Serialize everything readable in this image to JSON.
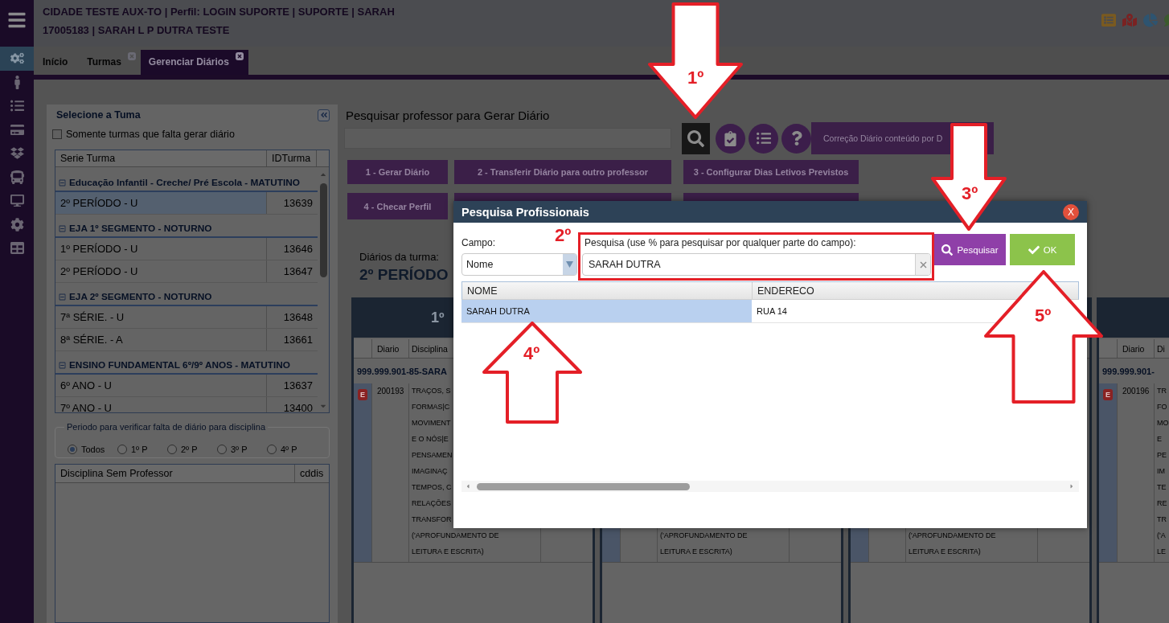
{
  "sidebar": {
    "items": [
      {
        "selected": true
      },
      {
        "selected": false
      },
      {
        "selected": false
      },
      {
        "selected": false
      },
      {
        "selected": false
      },
      {
        "selected": false
      },
      {
        "selected": false
      },
      {
        "selected": false
      },
      {
        "selected": false
      }
    ]
  },
  "header": {
    "lines": [
      "CIDADE TESTE AUX-TO | Perfil: LOGIN SUPORTE | SUPORTE | SARAH",
      "17005183 | SARAH L P DUTRA TESTE"
    ]
  },
  "tabs": [
    {
      "label": "Início",
      "selected": false,
      "closable": false
    },
    {
      "label": "Turmas",
      "selected": false,
      "closable": true
    },
    {
      "label": "Gerenciar Diários",
      "selected": true,
      "closable": true
    }
  ],
  "class_panel": {
    "title": "Selecione a Tuma",
    "filter": {
      "label": "Somente turmas que falta gerar diário",
      "checked": false
    },
    "grid": {
      "columns": [
        "Serie Turma",
        "IDTurma"
      ],
      "groups": [
        {
          "title": "Educação Infantil - Creche/ Pré Escola - MATUTINO",
          "expanded": true,
          "rows": [
            {
              "serie": "2º PERÍODO - U",
              "id": "13639",
              "selected": true
            }
          ]
        },
        {
          "title": "EJA 1º SEGMENTO - NOTURNO",
          "expanded": true,
          "rows": [
            {
              "serie": "1º PERÍODO - U",
              "id": "13646",
              "selected": false
            },
            {
              "serie": "2º PERÍODO - U",
              "id": "13647",
              "selected": false
            }
          ]
        },
        {
          "title": "EJA 2º SEGMENTO - NOTURNO",
          "expanded": true,
          "rows": [
            {
              "serie": "7ª SÉRIE. - U",
              "id": "13648",
              "selected": false
            },
            {
              "serie": "8ª SÉRIE. - A",
              "id": "13661",
              "selected": false
            }
          ]
        },
        {
          "title": "ENSINO FUNDAMENTAL 6º/9º ANOS - MATUTINO",
          "expanded": true,
          "rows": [
            {
              "serie": "6º ANO - U",
              "id": "13637",
              "selected": false
            },
            {
              "serie": "7º ANO - U",
              "id": "13400",
              "selected": false
            }
          ]
        }
      ]
    },
    "period": {
      "legend": "Periodo para verificar falta de diário para disciplina",
      "options": [
        {
          "label": "Todos",
          "selected": true
        },
        {
          "label": "1º P",
          "selected": false
        },
        {
          "label": "2º P",
          "selected": false
        },
        {
          "label": "3º P",
          "selected": false
        },
        {
          "label": "4º P",
          "selected": false
        }
      ]
    },
    "subject_grid": {
      "columns": [
        "Disciplina Sem Professor",
        "cddis"
      ]
    }
  },
  "teacher_search": {
    "title": "Pesquisar professor para Gerar Diário",
    "correction_button": "Correção Diário conteúdo por D",
    "actions": [
      [
        {
          "label": "1 - Gerar Diário"
        },
        {
          "label": "2 - Transferir Diário para outro professor"
        },
        {
          "label": "3 - Configurar Dias Letivos Previstos"
        }
      ],
      [
        {
          "label": "4 - Checar Perfil"
        }
      ]
    ]
  },
  "diaries": {
    "label": "Diários da turma:",
    "class_name": "2º PERÍODO",
    "cards": [
      {
        "title": "1º",
        "columns": [
          "Diario",
          "Disciplina"
        ],
        "teacher": "999.999.901-85-SARA",
        "rows": [
          {
            "badge": "E",
            "diario": "200193",
            "disciplina": [
              "TRAÇOS, S",
              "FORMAS|C",
              "MOVIMENT",
              "E O NÓS|E",
              "PENSAMEN",
              "IMAGINAÇ",
              "TEMPOS, C",
              "RELAÇÕES",
              "TRANSFOR",
              "('APROFUNDAMENTO DE",
              "LEITURA E ESCRITA)"
            ]
          }
        ]
      },
      {
        "rows": [
          {
            "disciplina": [
              "('APROFUNDAMENTO DE",
              "LEITURA E ESCRITA)"
            ]
          }
        ]
      },
      {
        "rows": [
          {
            "disciplina": [
              "('APROFUNDAMENTO DE",
              "LEITURA E ESCRITA)"
            ]
          }
        ]
      },
      {
        "columns": [
          "Diario",
          "Di"
        ],
        "teacher": "999.999.901-",
        "rows": [
          {
            "badge": "E",
            "diario": "200196",
            "disciplina": [
              "TR",
              "FO",
              "MO",
              "E",
              "PE",
              "IM",
              "TE",
              "RE",
              "TR",
              "('A",
              "LE"
            ]
          }
        ]
      }
    ]
  },
  "search_dialog": {
    "title": "Pesquisa Profissionais",
    "close_label": "X",
    "field_label": "Campo:",
    "field_value": "Nome",
    "query_label": "Pesquisa (use % para pesquisar por qualquer parte do campo):",
    "query_value": "SARAH DUTRA",
    "search_button": "Pesquisar",
    "ok_button": "OK",
    "results": {
      "columns": [
        "NOME",
        "ENDERECO"
      ],
      "rows": [
        {
          "nome": "SARAH DUTRA",
          "endereco": "RUA 14",
          "selected": true
        }
      ]
    }
  },
  "annotations": [
    {
      "kind": "down_arrow",
      "label": "1º"
    },
    {
      "kind": "note",
      "label": "2º"
    },
    {
      "kind": "frame"
    },
    {
      "kind": "down_arrow",
      "label": "3º"
    },
    {
      "kind": "up_arrow",
      "label": "4º"
    },
    {
      "kind": "up_arrow",
      "label": "5º"
    }
  ]
}
